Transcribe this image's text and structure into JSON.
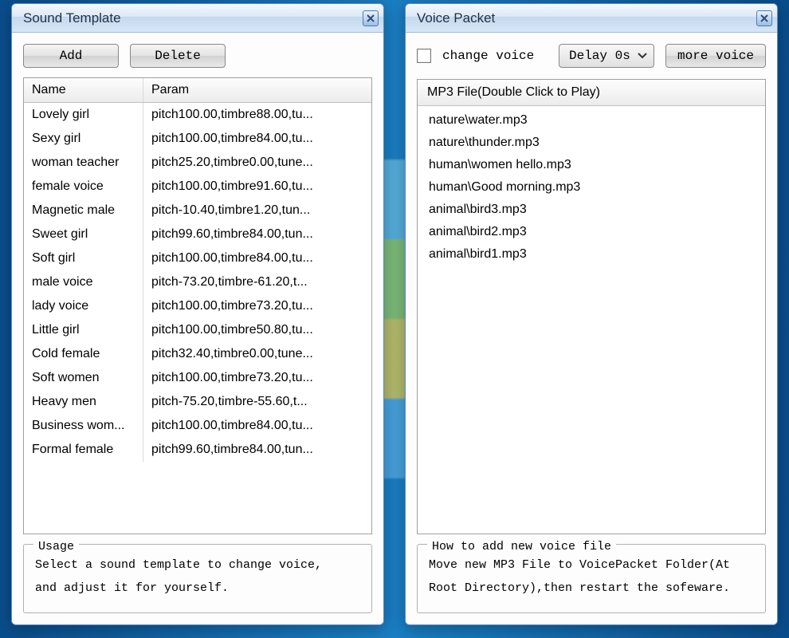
{
  "left_window": {
    "title": "Sound Template",
    "buttons": {
      "add": "Add",
      "delete": "Delete"
    },
    "columns": {
      "name": "Name",
      "param": "Param"
    },
    "rows": [
      {
        "name": "Lovely girl",
        "param": "pitch100.00,timbre88.00,tu..."
      },
      {
        "name": "Sexy girl",
        "param": "pitch100.00,timbre84.00,tu..."
      },
      {
        "name": "woman teacher",
        "param": "pitch25.20,timbre0.00,tune..."
      },
      {
        "name": "female voice",
        "param": "pitch100.00,timbre91.60,tu..."
      },
      {
        "name": "Magnetic male",
        "param": "pitch-10.40,timbre1.20,tun..."
      },
      {
        "name": "Sweet girl",
        "param": "pitch99.60,timbre84.00,tun..."
      },
      {
        "name": "Soft girl",
        "param": "pitch100.00,timbre84.00,tu..."
      },
      {
        "name": "male voice",
        "param": "pitch-73.20,timbre-61.20,t..."
      },
      {
        "name": "lady voice",
        "param": "pitch100.00,timbre73.20,tu..."
      },
      {
        "name": "Little girl",
        "param": "pitch100.00,timbre50.80,tu..."
      },
      {
        "name": "Cold female",
        "param": "pitch32.40,timbre0.00,tune..."
      },
      {
        "name": "Soft women",
        "param": "pitch100.00,timbre73.20,tu..."
      },
      {
        "name": "Heavy men",
        "param": "pitch-75.20,timbre-55.60,t..."
      },
      {
        "name": "Business wom...",
        "param": "pitch100.00,timbre84.00,tu..."
      },
      {
        "name": "Formal female",
        "param": "pitch99.60,timbre84.00,tun..."
      }
    ],
    "usage": {
      "title": "Usage",
      "line1": "Select a sound template to change voice,",
      "line2": "and adjust it for yourself."
    }
  },
  "right_window": {
    "title": "Voice Packet",
    "change_voice_label": "change voice",
    "delay_label": "Delay 0s",
    "more_voice": "more voice",
    "list_header": "MP3 File(Double Click to Play)",
    "items": [
      "nature\\water.mp3",
      "nature\\thunder.mp3",
      "human\\women hello.mp3",
      "human\\Good morning.mp3",
      "animal\\bird3.mp3",
      "animal\\bird2.mp3",
      "animal\\bird1.mp3"
    ],
    "help": {
      "title": "How to add new voice file",
      "line1": "Move new MP3 File to VoicePacket Folder(At",
      "line2": "Root Directory),then restart the sofeware."
    }
  }
}
